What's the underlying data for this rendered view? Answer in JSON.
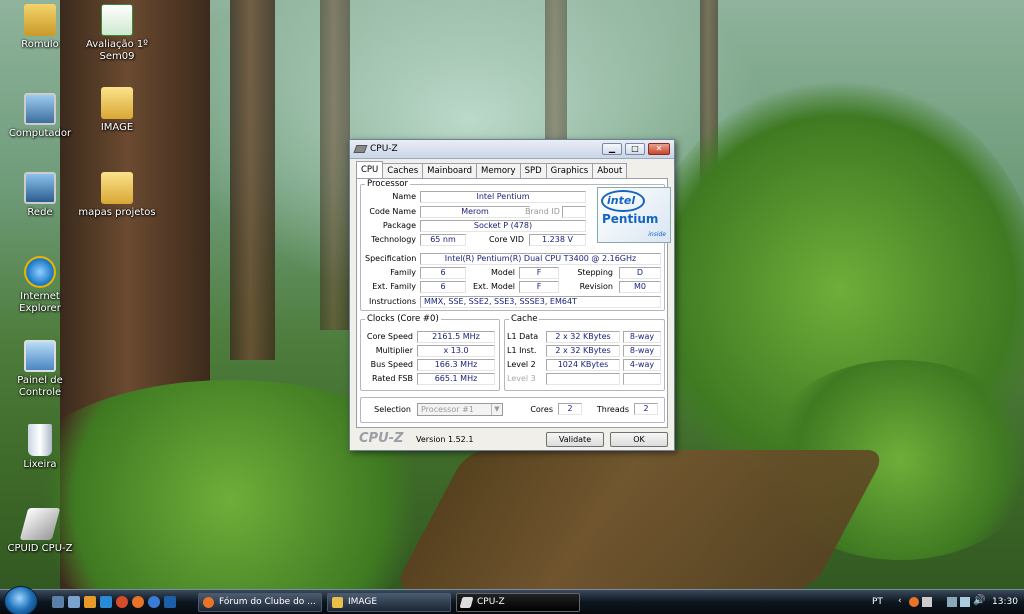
{
  "desktop": {
    "icons": [
      {
        "label": "Romulo"
      },
      {
        "label": "Avaliação 1º Sem09"
      },
      {
        "label": "Computador"
      },
      {
        "label": "IMAGE"
      },
      {
        "label": "Rede"
      },
      {
        "label": "mapas projetos"
      },
      {
        "label": "Internet Explorer"
      },
      {
        "label": "Painel de Controle"
      },
      {
        "label": "Lixeira"
      },
      {
        "label": "CPUID CPU-Z"
      }
    ]
  },
  "window": {
    "title": "CPU-Z",
    "controls": {
      "minimize": "▁",
      "maximize": "□",
      "close": "✕"
    },
    "tabs": [
      "CPU",
      "Caches",
      "Mainboard",
      "Memory",
      "SPD",
      "Graphics",
      "About"
    ],
    "active_tab": "CPU",
    "processor": {
      "legend": "Processor",
      "name_label": "Name",
      "name": "Intel Pentium",
      "codename_label": "Code Name",
      "codename": "Merom",
      "brandid_label": "Brand ID",
      "brandid": "",
      "package_label": "Package",
      "package": "Socket P (478)",
      "technology_label": "Technology",
      "technology": "65 nm",
      "corevid_label": "Core VID",
      "corevid": "1.238 V",
      "spec_label": "Specification",
      "spec": "Intel(R) Pentium(R) Dual  CPU  T3400  @ 2.16GHz",
      "family_label": "Family",
      "family": "6",
      "model_label": "Model",
      "model": "F",
      "stepping_label": "Stepping",
      "stepping": "D",
      "extfamily_label": "Ext. Family",
      "extfamily": "6",
      "extmodel_label": "Ext. Model",
      "extmodel": "F",
      "revision_label": "Revision",
      "revision": "M0",
      "instructions_label": "Instructions",
      "instructions": "MMX, SSE, SSE2, SSE3, SSSE3, EM64T"
    },
    "logo": {
      "brand": "intel",
      "product": "Pentium",
      "tag": "inside"
    },
    "clocks": {
      "legend": "Clocks (Core #0)",
      "core_speed_label": "Core Speed",
      "core_speed": "2161.5 MHz",
      "multiplier_label": "Multiplier",
      "multiplier": "x 13.0",
      "bus_speed_label": "Bus Speed",
      "bus_speed": "166.3 MHz",
      "rated_fsb_label": "Rated FSB",
      "rated_fsb": "665.1 MHz"
    },
    "cache": {
      "legend": "Cache",
      "rows": [
        {
          "label": "L1 Data",
          "size": "2 x 32 KBytes",
          "way": "8-way"
        },
        {
          "label": "L1 Inst.",
          "size": "2 x 32 KBytes",
          "way": "8-way"
        },
        {
          "label": "Level 2",
          "size": "1024 KBytes",
          "way": "4-way"
        },
        {
          "label": "Level 3",
          "size": "",
          "way": ""
        }
      ]
    },
    "selection": {
      "label": "Selection",
      "value": "Processor #1",
      "cores_label": "Cores",
      "cores": "2",
      "threads_label": "Threads",
      "threads": "2"
    },
    "footer": {
      "brand": "CPU-Z",
      "version": "Version 1.52.1",
      "validate": "Validate",
      "ok": "OK"
    }
  },
  "taskbar": {
    "tasks": [
      {
        "label": "Fórum do Clube do ..."
      },
      {
        "label": "IMAGE"
      },
      {
        "label": "CPU-Z"
      }
    ],
    "language": "PT",
    "clock": "13:30"
  }
}
